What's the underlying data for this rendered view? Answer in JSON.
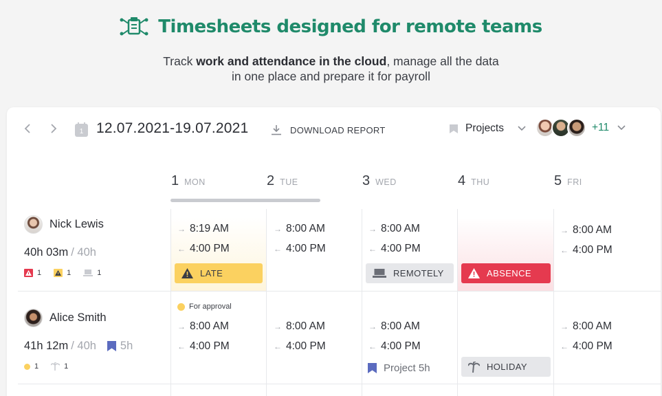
{
  "hero": {
    "title": "Timesheets designed for remote teams",
    "subtitle_pre": "Track ",
    "subtitle_bold": "work and attendance in the cloud",
    "subtitle_post": ", manage all the data",
    "subtitle_line2": "in one place and prepare it for payroll"
  },
  "toolbar": {
    "date_range": "12.07.2021-19.07.2021",
    "calendar_day": "1",
    "download_label": "DOWNLOAD REPORT",
    "projects_label": "Projects",
    "more_count": "+11"
  },
  "days": [
    {
      "num": "1",
      "name": "MON"
    },
    {
      "num": "2",
      "name": "TUE"
    },
    {
      "num": "3",
      "name": "WED"
    },
    {
      "num": "4",
      "name": "THU"
    },
    {
      "num": "5",
      "name": "FRI"
    }
  ],
  "rows": [
    {
      "name": "Nick Lewis",
      "worked": "40h 03m",
      "total": " / 40h",
      "stats": {
        "absence": "1",
        "late": "1",
        "remote": "1"
      },
      "mon": {
        "in": "8:19 AM",
        "out": "4:00 PM",
        "badge": "LATE"
      },
      "tue": {
        "in": "8:00 AM",
        "out": "4:00 PM"
      },
      "wed": {
        "in": "8:00 AM",
        "out": "4:00 PM",
        "badge": "REMOTELY"
      },
      "thu": {
        "badge": "ABSENCE"
      },
      "fri": {
        "in": "8:00 AM",
        "out": "4:00 PM"
      }
    },
    {
      "name": "Alice Smith",
      "worked": "41h 12m",
      "total": " / 40h",
      "project_hours": "5h",
      "stats": {
        "approval": "1",
        "holiday": "1"
      },
      "mon": {
        "status": "For approval",
        "in": "8:00 AM",
        "out": "4:00 PM"
      },
      "tue": {
        "in": "8:00 AM",
        "out": "4:00 PM"
      },
      "wed": {
        "in": "8:00 AM",
        "out": "4:00 PM",
        "project": "Project 5h"
      },
      "thu": {
        "badge": "HOLIDAY"
      },
      "fri": {
        "in": "8:00 AM",
        "out": "4:00 PM"
      }
    }
  ],
  "arrows": {
    "in": "→",
    "out": "←"
  },
  "colors": {
    "brand": "#1f8a6a",
    "late": "#fbd160",
    "absence": "#e53a4f",
    "neutral_badge": "#e6e7ea",
    "project": "#5b6bbf"
  }
}
